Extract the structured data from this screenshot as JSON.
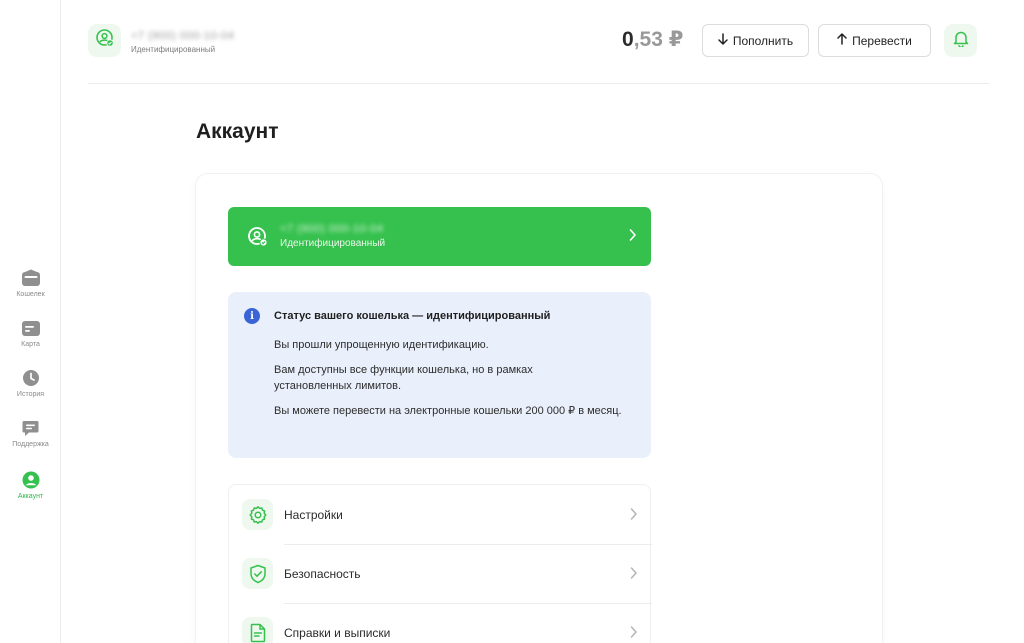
{
  "sidebar": {
    "items": [
      {
        "label": "Кошелек",
        "icon": "wallet-icon",
        "active": false
      },
      {
        "label": "Карта",
        "icon": "card-icon",
        "active": false
      },
      {
        "label": "История",
        "icon": "clock-icon",
        "active": false
      },
      {
        "label": "Поддержка",
        "icon": "chat-icon",
        "active": false
      },
      {
        "label": "Аккаунт",
        "icon": "user-icon",
        "active": true
      }
    ]
  },
  "header": {
    "phone": "+7 (900) 000-10-04",
    "status": "Идентифицированный",
    "balance_int": "0",
    "balance_frac": ",53 ₽",
    "topup_label": "Пополнить",
    "transfer_label": "Перевести"
  },
  "page": {
    "title": "Аккаунт"
  },
  "account_banner": {
    "phone": "+7 (900) 000-10-04",
    "status": "Идентифицированный"
  },
  "info": {
    "title": "Статус вашего кошелька — идентифицированный",
    "p1": "Вы прошли упрощенную идентификацию.",
    "p2": "Вам доступны все функции кошелька, но в рамках установленных лимитов.",
    "p3": "Вы можете перевести на электронные кошельки 200 000 ₽ в месяц."
  },
  "menu": {
    "items": [
      {
        "label": "Настройки",
        "icon": "gear-icon"
      },
      {
        "label": "Безопасность",
        "icon": "shield-check-icon"
      },
      {
        "label": "Справки и выписки",
        "icon": "document-icon"
      }
    ]
  },
  "colors": {
    "accent": "#36c14e",
    "info_bg": "#eaf0fb",
    "info_icon": "#3a63d6"
  }
}
